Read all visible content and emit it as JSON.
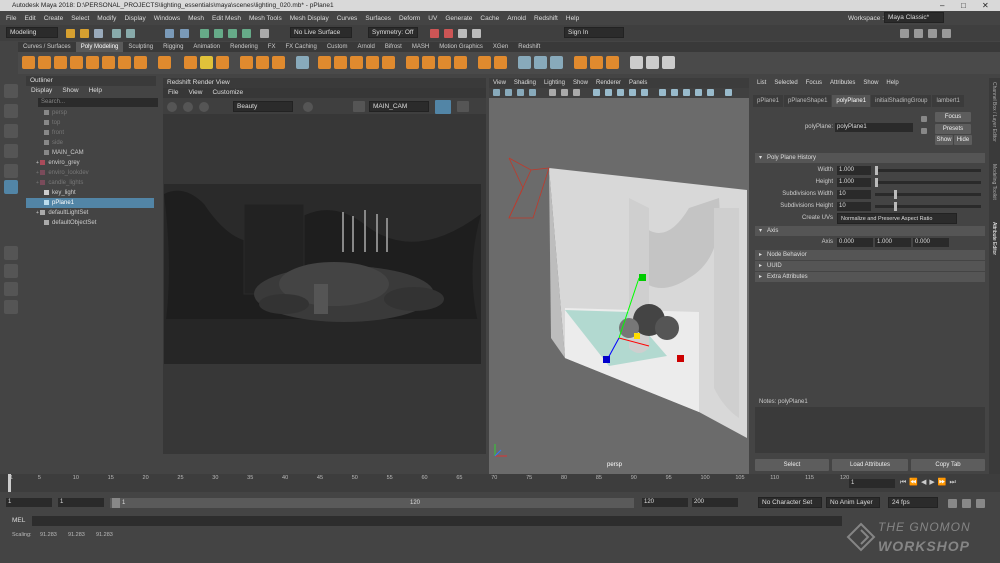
{
  "window": {
    "title": "Autodesk Maya 2018: D:\\PERSONAL_PROJECTS\\lighting_essentials\\maya\\scenes\\lighting_020.mb* - pPlane1",
    "controls": [
      "–",
      "□",
      "✕"
    ]
  },
  "menubar": {
    "items": [
      "File",
      "Edit",
      "Create",
      "Select",
      "Modify",
      "Display",
      "Windows",
      "Mesh",
      "Edit Mesh",
      "Mesh Tools",
      "Mesh Display",
      "Curves",
      "Surfaces",
      "Deform",
      "UV",
      "Generate",
      "Cache",
      "Arnold",
      "Redshift",
      "Help"
    ],
    "workspace_label": "Workspace :",
    "workspace_value": "Maya Classic*"
  },
  "statusline": {
    "mode": "Modeling",
    "live_surface": "No Live Surface",
    "symmetry": "Symmetry: Off",
    "sign_in": "Sign In"
  },
  "shelf": {
    "tabs": [
      "Curves / Surfaces",
      "Poly Modeling",
      "Sculpting",
      "Rigging",
      "Animation",
      "Rendering",
      "FX",
      "FX Caching",
      "Custom",
      "Arnold",
      "Bifrost",
      "MASH",
      "Motion Graphics",
      "XGen",
      "Redshift"
    ],
    "active_tab": "Poly Modeling",
    "accent": "#e08a2e"
  },
  "outliner": {
    "title": "Outliner",
    "menu": [
      "Display",
      "Show",
      "Help"
    ],
    "search_placeholder": "Search...",
    "items": [
      {
        "label": "persp",
        "dim": true,
        "indent": 1
      },
      {
        "label": "top",
        "dim": true,
        "indent": 1
      },
      {
        "label": "front",
        "dim": true,
        "indent": 1
      },
      {
        "label": "side",
        "dim": true,
        "indent": 1
      },
      {
        "label": "MAIN_CAM",
        "dim": false,
        "indent": 1
      },
      {
        "label": "enviro_grey",
        "dim": false,
        "indent": 0
      },
      {
        "label": "enviro_lookdev",
        "dim": true,
        "indent": 0
      },
      {
        "label": "candle_lights",
        "dim": true,
        "indent": 0
      },
      {
        "label": "key_light",
        "dim": false,
        "indent": 1
      },
      {
        "label": "pPlane1",
        "dim": false,
        "indent": 1,
        "selected": true
      },
      {
        "label": "defaultLightSet",
        "dim": false,
        "indent": 0
      },
      {
        "label": "defaultObjectSet",
        "dim": false,
        "indent": 1
      }
    ]
  },
  "render_view": {
    "title": "Redshift Render View",
    "menu": [
      "File",
      "View",
      "Customize"
    ],
    "aov": "Beauty",
    "camera": "MAIN_CAM"
  },
  "viewport": {
    "menu": [
      "View",
      "Shading",
      "Lighting",
      "Show",
      "Renderer",
      "Panels"
    ],
    "camera_label": "persp"
  },
  "attribute_editor": {
    "menu": [
      "List",
      "Selected",
      "Focus",
      "Attributes",
      "Show",
      "Help"
    ],
    "tabs": [
      "pPlane1",
      "pPlaneShape1",
      "polyPlane1",
      "initialShadingGroup",
      "lambert1"
    ],
    "active_tab": "polyPlane1",
    "node_label": "polyPlane:",
    "node_value": "polyPlane1",
    "buttons": {
      "focus": "Focus",
      "presets": "Presets",
      "show": "Show",
      "hide": "Hide"
    },
    "history_section": "Poly Plane History",
    "fields": [
      {
        "label": "Width",
        "value": "1.000"
      },
      {
        "label": "Height",
        "value": "1.000"
      },
      {
        "label": "Subdivisions Width",
        "value": "10"
      },
      {
        "label": "Subdivisions Height",
        "value": "10"
      }
    ],
    "create_uvs_label": "Create UVs",
    "create_uvs_value": "Normalize and Preserve Aspect Ratio",
    "axis_section": "Axis",
    "axis_label": "Axis",
    "axis_values": [
      "0.000",
      "1.000",
      "0.000"
    ],
    "collapsed_sections": [
      "Node Behavior",
      "UUID",
      "Extra Attributes"
    ],
    "notes_label": "Notes: polyPlane1",
    "bottom_buttons": [
      "Select",
      "Load Attributes",
      "Copy Tab"
    ]
  },
  "side_strip": [
    "Channel Box / Layer Editor",
    "Modeling Toolkit",
    "Attribute Editor"
  ],
  "timeline": {
    "ticks": [
      "1",
      "5",
      "10",
      "15",
      "20",
      "25",
      "30",
      "35",
      "40",
      "45",
      "50",
      "55",
      "60",
      "65",
      "70",
      "75",
      "80",
      "85",
      "90",
      "95",
      "100",
      "105",
      "110",
      "115",
      "120"
    ],
    "current_frame": "1"
  },
  "range": {
    "start": "1",
    "start2": "1",
    "slider_start": "1",
    "slider_end": "120",
    "end": "120",
    "end2": "200",
    "character_set": "No Character Set",
    "anim_layer": "No Anim Layer",
    "fps": "24 fps"
  },
  "mel": {
    "label": "MEL"
  },
  "helpline": {
    "label": "Scaling:",
    "values": [
      "91.283",
      "91.283",
      "91.283"
    ]
  },
  "watermark": {
    "line1": "THE GNOMON",
    "line2": "WORKSHOP"
  }
}
